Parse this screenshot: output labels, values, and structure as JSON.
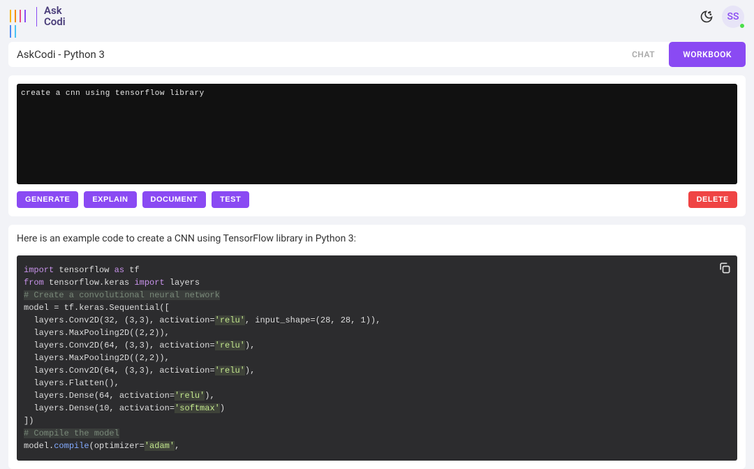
{
  "brand": {
    "line1": "Ask",
    "line2": "Codi"
  },
  "avatar_initials": "SS",
  "page_title": "AskCodi - Python 3",
  "tabs": {
    "chat": "CHAT",
    "workbook": "WORKBOOK"
  },
  "input_code": "create a cnn using tensorflow library",
  "buttons": {
    "generate": "GENERATE",
    "explain": "EXPLAIN",
    "document": "DOCUMENT",
    "test": "TEST",
    "delete": "DELETE"
  },
  "output_intro": "Here is an example code to create a CNN using TensorFlow library in Python 3:",
  "code": {
    "l1_import": "import",
    "l1_tf": " tensorflow ",
    "l1_as": "as",
    "l1_tfalias": " tf",
    "l2_from": "from",
    "l2_mod": " tensorflow.keras ",
    "l2_import": "import",
    "l2_layers": " layers",
    "l3_blank": "",
    "l4_comment": "# Create a convolutional neural network",
    "l5": "model = tf.keras.Sequential([",
    "l6a": "  layers.Conv2D(32, (3,3), activation=",
    "l6s": "'relu'",
    "l6b": ", input_shape=(28, 28, 1)),",
    "l7": "  layers.MaxPooling2D((2,2)),",
    "l8a": "  layers.Conv2D(64, (3,3), activation=",
    "l8s": "'relu'",
    "l8b": "),",
    "l9": "  layers.MaxPooling2D((2,2)),",
    "l10a": "  layers.Conv2D(64, (3,3), activation=",
    "l10s": "'relu'",
    "l10b": "),",
    "l11": "  layers.Flatten(),",
    "l12a": "  layers.Dense(64, activation=",
    "l12s": "'relu'",
    "l12b": "),",
    "l13a": "  layers.Dense(10, activation=",
    "l13s": "'softmax'",
    "l13b": ")",
    "l14": "])",
    "l15_blank": "",
    "l16_comment": "# Compile the model",
    "l17a": "model.",
    "l17f": "compile",
    "l17b": "(optimizer=",
    "l17s": "'adam'",
    "l17c": ","
  }
}
